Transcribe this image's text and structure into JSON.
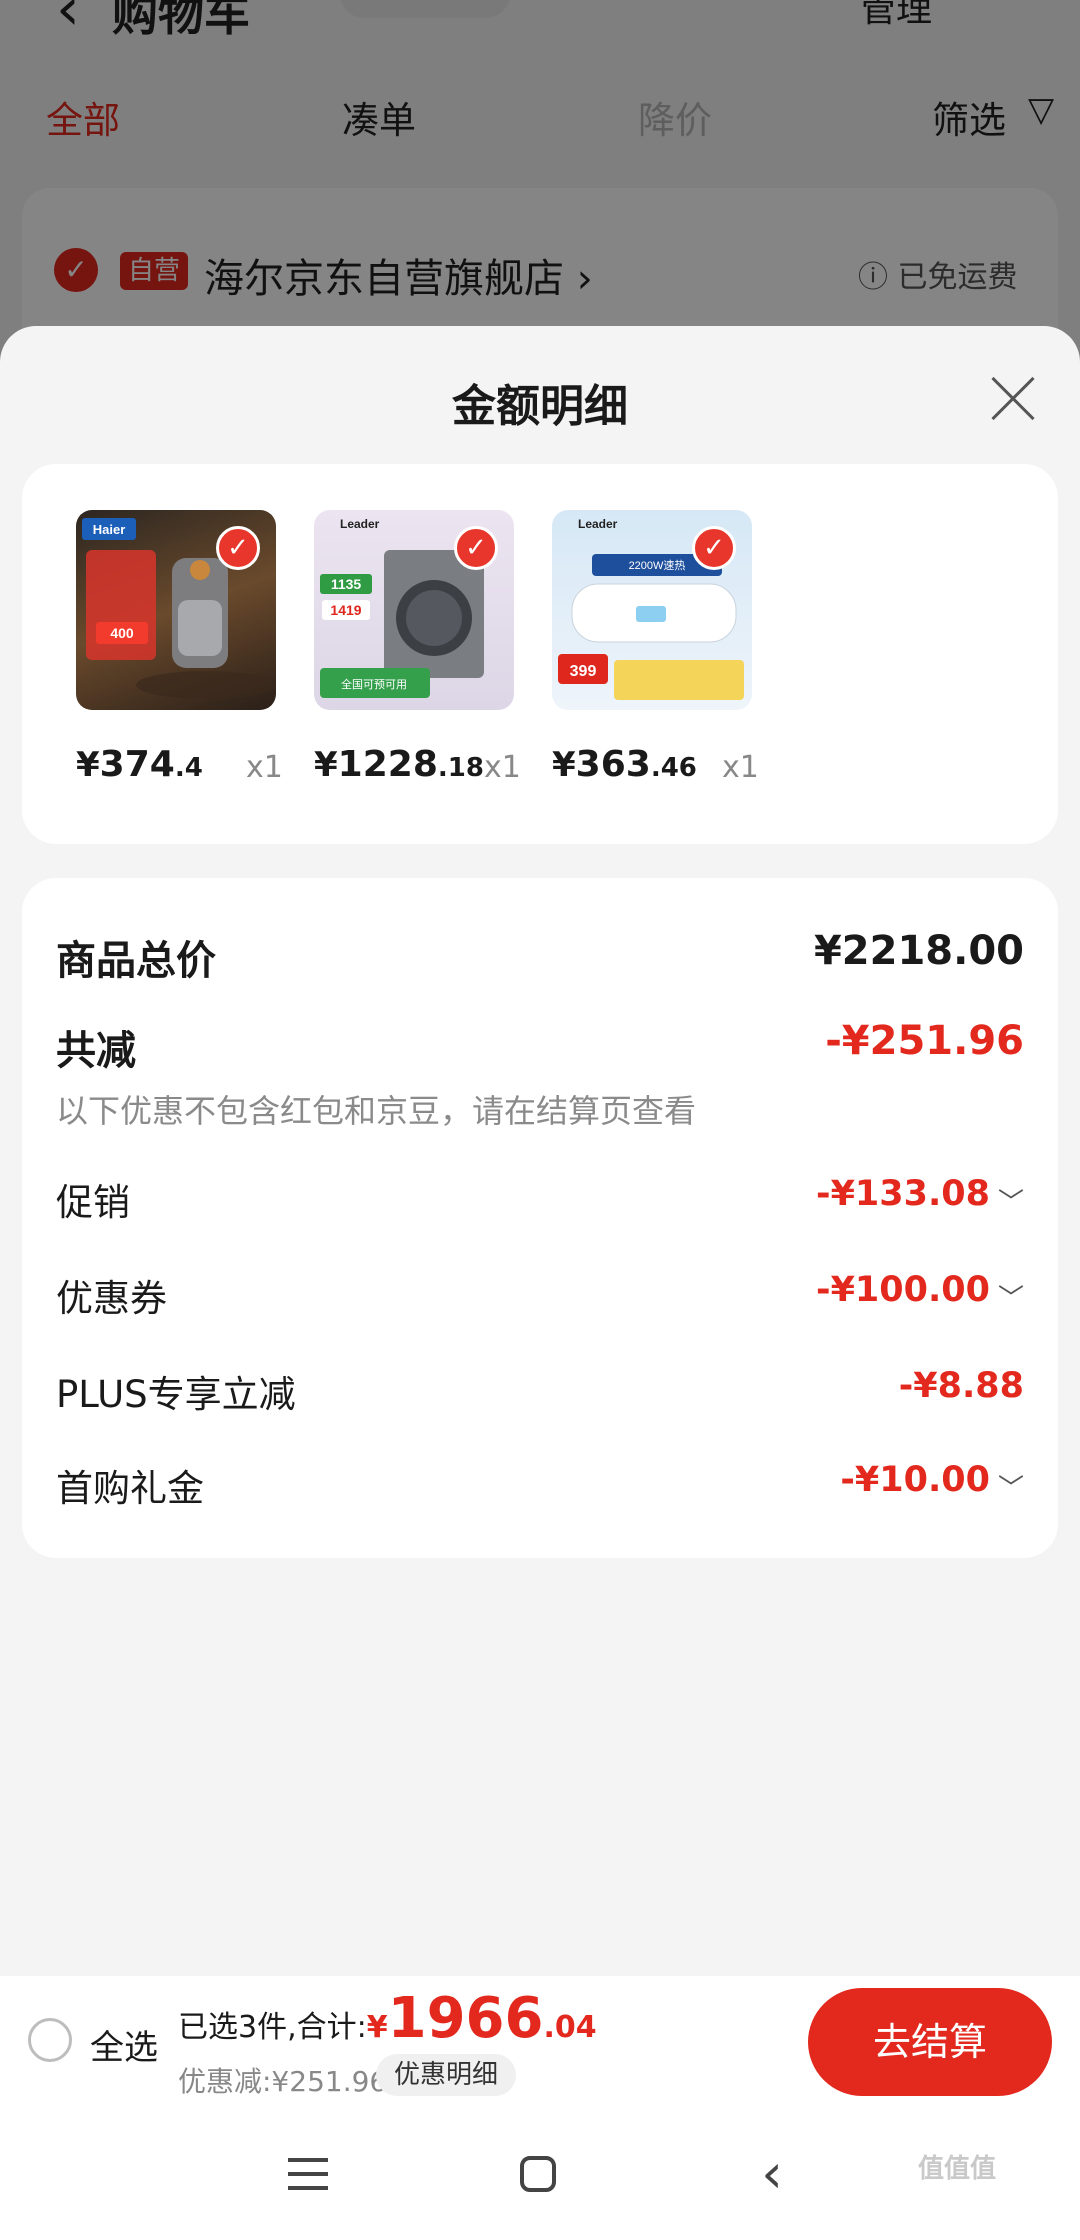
{
  "background": {
    "title": "购物车",
    "manage_label": "管理",
    "tabs": [
      {
        "label": "全部"
      },
      {
        "label": "凑单"
      },
      {
        "label": "降价"
      },
      {
        "label": "筛选"
      }
    ],
    "store": {
      "self_tag": "自营",
      "name": "海尔京东自营旗舰店 ›",
      "shipping": "ⓘ 已免运费"
    }
  },
  "sheet": {
    "title": "金额明细",
    "products": [
      {
        "name": "haier-filter",
        "yen": "¥",
        "price_int": "374",
        "price_dec": ".4",
        "qty": "x1"
      },
      {
        "name": "leader-washer",
        "yen": "¥",
        "price_int": "1228",
        "price_dec": ".18",
        "qty": "x1"
      },
      {
        "name": "leader-heater",
        "yen": "¥",
        "price_int": "363",
        "price_dec": ".46",
        "qty": "x1"
      }
    ],
    "summary": {
      "total_label": "商品总价",
      "total_value": "¥2218.00",
      "reduce_label": "共减",
      "reduce_value": "-¥251.96",
      "reduce_note": "以下优惠不包含红包和京豆，请在结算页查看",
      "details": [
        {
          "label": "促销",
          "value": "-¥133.08",
          "expandable": true
        },
        {
          "label": "优惠券",
          "value": "-¥100.00",
          "expandable": true
        },
        {
          "label": "PLUS专享立减",
          "value": "-¥8.88",
          "expandable": false
        },
        {
          "label": "首购礼金",
          "value": "-¥10.00",
          "expandable": true
        }
      ]
    }
  },
  "bottom_bar": {
    "select_all_label": "全选",
    "selected_text": "已选3件,合计:",
    "total_yen": "¥",
    "total_int": "1966",
    "total_dec": ".04",
    "discount_text": "优惠减:¥251.96",
    "detail_button": "优惠明细",
    "checkout_button": "去结算"
  },
  "watermark": "值值值",
  "colors": {
    "accent": "#e3281e",
    "sheet_bg": "#f4f4f4",
    "card_bg": "#ffffff"
  }
}
